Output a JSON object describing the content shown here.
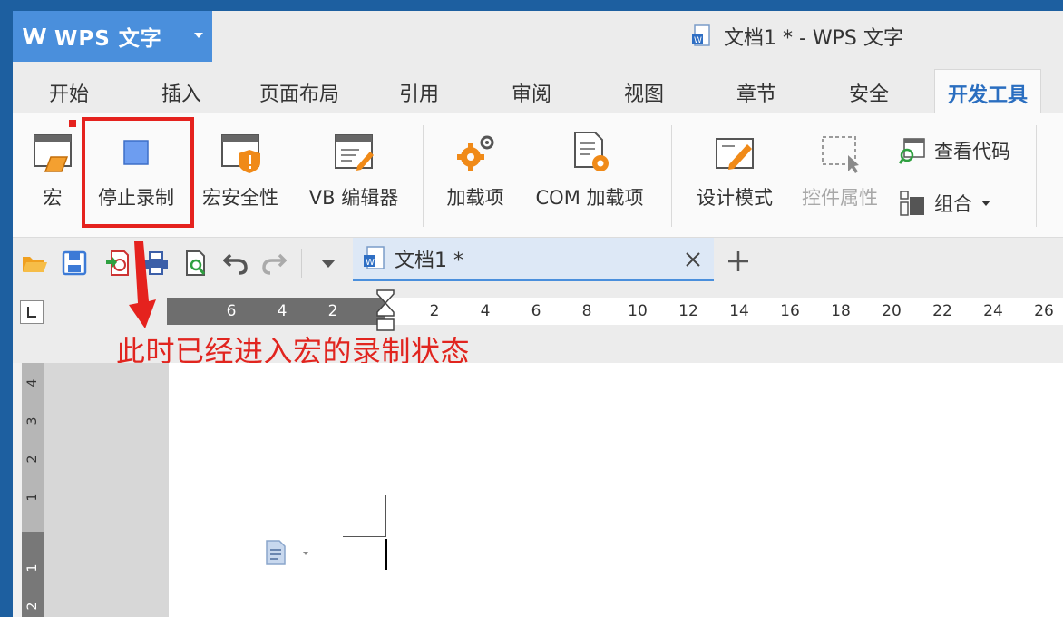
{
  "app": {
    "name": "WPS 文字",
    "window_title": "文档1 * - WPS 文字",
    "accent": "#4a8fdc"
  },
  "tabs": [
    {
      "label": "开始"
    },
    {
      "label": "插入"
    },
    {
      "label": "页面布局"
    },
    {
      "label": "引用"
    },
    {
      "label": "审阅"
    },
    {
      "label": "视图"
    },
    {
      "label": "章节"
    },
    {
      "label": "安全"
    },
    {
      "label": "开发工具",
      "active": true
    }
  ],
  "ribbon": {
    "macro": {
      "label": "宏",
      "icon": "macro-icon"
    },
    "stop_record": {
      "label": "停止录制",
      "icon": "stop-square-icon"
    },
    "macro_security": {
      "label": "宏安全性",
      "icon": "shield-warning-icon"
    },
    "vb_editor": {
      "label": "VB 编辑器",
      "icon": "vb-editor-icon"
    },
    "addins": {
      "label": "加载项",
      "icon": "gears-icon"
    },
    "com_addins": {
      "label": "COM 加载项",
      "icon": "document-gear-icon"
    },
    "design_mode": {
      "label": "设计模式",
      "icon": "design-mode-icon"
    },
    "control_props": {
      "label": "控件属性",
      "icon": "control-properties-icon"
    },
    "view_code": {
      "label": "查看代码",
      "icon": "view-code-icon"
    },
    "group": {
      "label": "组合",
      "icon": "group-icon"
    }
  },
  "document_tab": {
    "name": "文档1 *"
  },
  "ruler": {
    "ticks": [
      "6",
      "4",
      "2",
      "2",
      "4",
      "6",
      "8",
      "10",
      "12",
      "14",
      "16",
      "18",
      "20",
      "22",
      "24",
      "26"
    ],
    "vertical_ticks": [
      "4",
      "3",
      "2",
      "1",
      "1",
      "2"
    ]
  },
  "annotation": {
    "text": "此时已经进入宏的录制状态",
    "color": "#e1251f"
  }
}
